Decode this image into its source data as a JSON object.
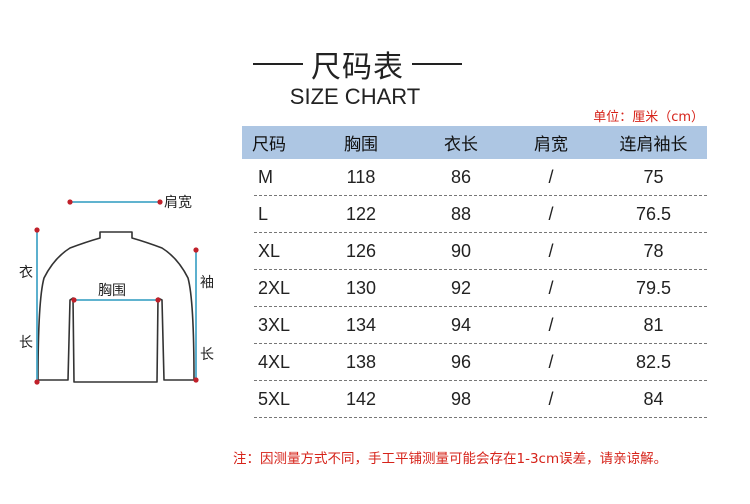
{
  "title": {
    "cn": "尺码表",
    "en": "SIZE CHART"
  },
  "unit_label": "单位：厘米（cm）",
  "table": {
    "headers": [
      "尺码",
      "胸围",
      "衣长",
      "肩宽",
      "连肩袖长"
    ],
    "rows": [
      [
        "M",
        "118",
        "86",
        "/",
        "75"
      ],
      [
        "L",
        "122",
        "88",
        "/",
        "76.5"
      ],
      [
        "XL",
        "126",
        "90",
        "/",
        "78"
      ],
      [
        "2XL",
        "130",
        "92",
        "/",
        "79.5"
      ],
      [
        "3XL",
        "134",
        "94",
        "/",
        "81"
      ],
      [
        "4XL",
        "138",
        "96",
        "/",
        "82.5"
      ],
      [
        "5XL",
        "142",
        "98",
        "/",
        "84"
      ]
    ]
  },
  "diagram": {
    "shoulder": "肩宽",
    "chest": "胸围",
    "length_1": "衣",
    "length_2": "长",
    "sleeve_1": "袖",
    "sleeve_2": "长"
  },
  "note": "注：因测量方式不同，手工平铺测量可能会存在1-3cm误差，请亲谅解。",
  "colors": {
    "header_bg": "#adc6e3",
    "accent_red": "#d6231a",
    "measure_line": "#4aa8c8"
  }
}
